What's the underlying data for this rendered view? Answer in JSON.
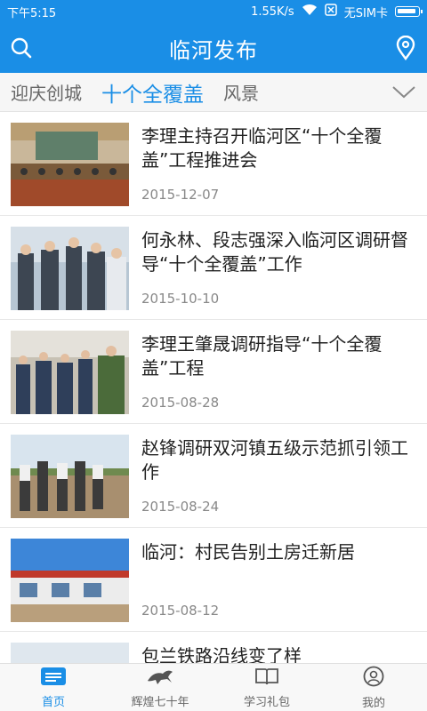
{
  "status_bar": {
    "time": "下午5:15",
    "speed": "1.55K/s",
    "sim": "无SIM卡"
  },
  "header": {
    "title": "临河发布",
    "icons": [
      "search-icon",
      "location-pin-icon"
    ]
  },
  "tabs": [
    {
      "label": "迎庆创城"
    },
    {
      "label": "十个全覆盖"
    },
    {
      "label": "风景"
    }
  ],
  "articles": [
    {
      "title": "李理主持召开临河区“十个全覆盖”工程推进会",
      "date": "2015-12-07"
    },
    {
      "title": "何永林、段志强深入临河区调研督导“十个全覆盖”工作",
      "date": "2015-10-10"
    },
    {
      "title": "李理王肇晟调研指导“十个全覆盖”工程",
      "date": "2015-08-28"
    },
    {
      "title": "赵锋调研双河镇五级示范抓引领工作",
      "date": "2015-08-24"
    },
    {
      "title": "临河：村民告别土房迁新居",
      "date": "2015-08-12"
    },
    {
      "title": "包兰铁路沿线变了样",
      "date": ""
    }
  ],
  "bottom_nav": [
    {
      "label": "首页",
      "icon": "home-icon"
    },
    {
      "label": "辉煌七十年",
      "icon": "horse-icon"
    },
    {
      "label": "学习礼包",
      "icon": "book-icon"
    },
    {
      "label": "我的",
      "icon": "user-icon"
    }
  ],
  "colors": {
    "primary": "#1a8ee6",
    "text": "#222222",
    "muted": "#888888"
  }
}
